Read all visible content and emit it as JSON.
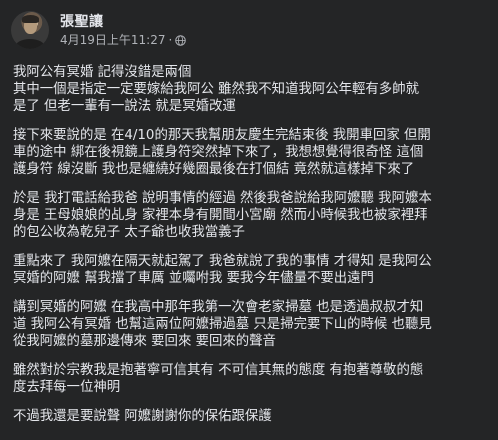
{
  "post": {
    "author": "張聖讓",
    "timestamp": "4月19日上午11:27",
    "separator": "·",
    "privacy_icon": "globe-icon",
    "paragraphs": [
      [
        "我阿公有冥婚 記得沒錯是兩個",
        "其中一個是指定一定要嫁給我阿公 雖然我不知道我阿公年輕有多帥就",
        "是了 但老一輩有一說法 就是冥婚改運"
      ],
      [
        "接下來要說的是 在4/10的那天我幫朋友慶生完結束後 我開車回家 但開",
        "車的途中 綁在後視鏡上護身符突然掉下來了，我想想覺得很奇怪 這個",
        "護身符 線沒斷 我也是纏繞好幾圈最後在打個結 竟然就這樣掉下來了"
      ],
      [
        "於是 我打電話給我爸 說明事情的經過 然後我爸說給我阿嬤聽 我阿嬤本",
        "身是 王母娘娘的乩身 家裡本身有開間小宮廟 然而小時候我也被家裡拜",
        "的包公收為乾兒子 太子爺也收我當義子"
      ],
      [
        "重點來了 我阿嬤在隔天就起駕了 我爸就說了我的事情 才得知 是我阿公",
        "冥婚的阿嬤 幫我擋了車厲 並囑咐我 要我今年儘量不要出遠門"
      ],
      [
        "講到冥婚的阿嬤 在我高中那年我第一次會老家掃墓 也是透過叔叔才知",
        "道 我阿公有冥婚 也幫這兩位阿嬤掃過墓 只是掃完要下山的時候 也聽見",
        "從我阿嬤的墓那邊傳來 要回來 要回來的聲音"
      ],
      [
        "雖然對於宗教我是抱著寧可信其有 不可信其無的態度 有抱著尊敬的態",
        "度去拜每一位神明"
      ],
      [
        "不過我還是要說聲 阿嬤謝謝你的保佑跟保護"
      ]
    ]
  },
  "colors": {
    "background": "#242526",
    "text_primary": "#e4e6eb",
    "text_secondary": "#b0b3b8"
  }
}
